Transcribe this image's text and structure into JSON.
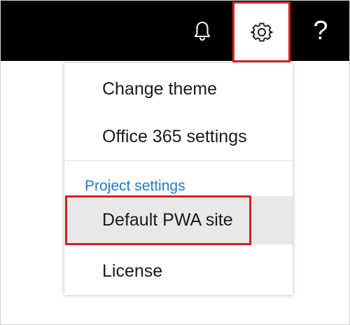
{
  "header": {
    "notifications_icon": "bell-icon",
    "settings_icon": "gear-icon",
    "help_icon": "question-mark-icon",
    "help_glyph": "?",
    "highlight_color": "#d61f26"
  },
  "settings_menu": {
    "items": [
      {
        "label": "Change theme"
      },
      {
        "label": "Office 365 settings"
      }
    ],
    "section": {
      "title": "Project settings",
      "title_color": "#1f7ac6",
      "items": [
        {
          "label": "Default PWA site",
          "hovered": true
        },
        {
          "label": "License"
        }
      ]
    }
  }
}
